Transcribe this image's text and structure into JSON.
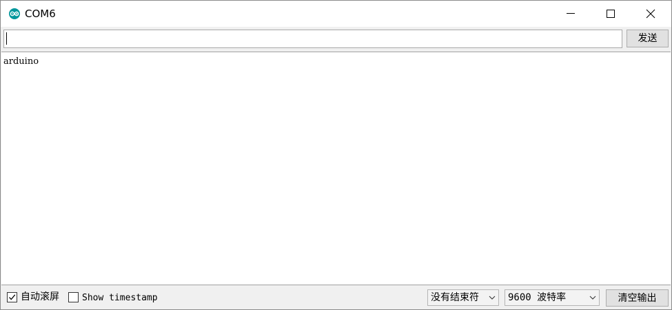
{
  "window": {
    "title": "COM6"
  },
  "send_bar": {
    "input_value": "",
    "send_label": "发送"
  },
  "output": {
    "text": "arduino"
  },
  "bottom_bar": {
    "autoscroll_label": "自动滚屏",
    "autoscroll_checked": true,
    "timestamp_label": "Show timestamp",
    "timestamp_checked": false,
    "line_ending_selected": "没有结束符",
    "baud_selected": "9600 波特率",
    "clear_label": "清空输出"
  },
  "colors": {
    "accent": "#00979c"
  },
  "icons": {
    "app": "arduino-logo-icon",
    "minimize": "minimize-icon",
    "maximize": "maximize-icon",
    "close": "close-icon",
    "dropdown": "chevron-down-icon",
    "check": "checkmark-icon"
  }
}
